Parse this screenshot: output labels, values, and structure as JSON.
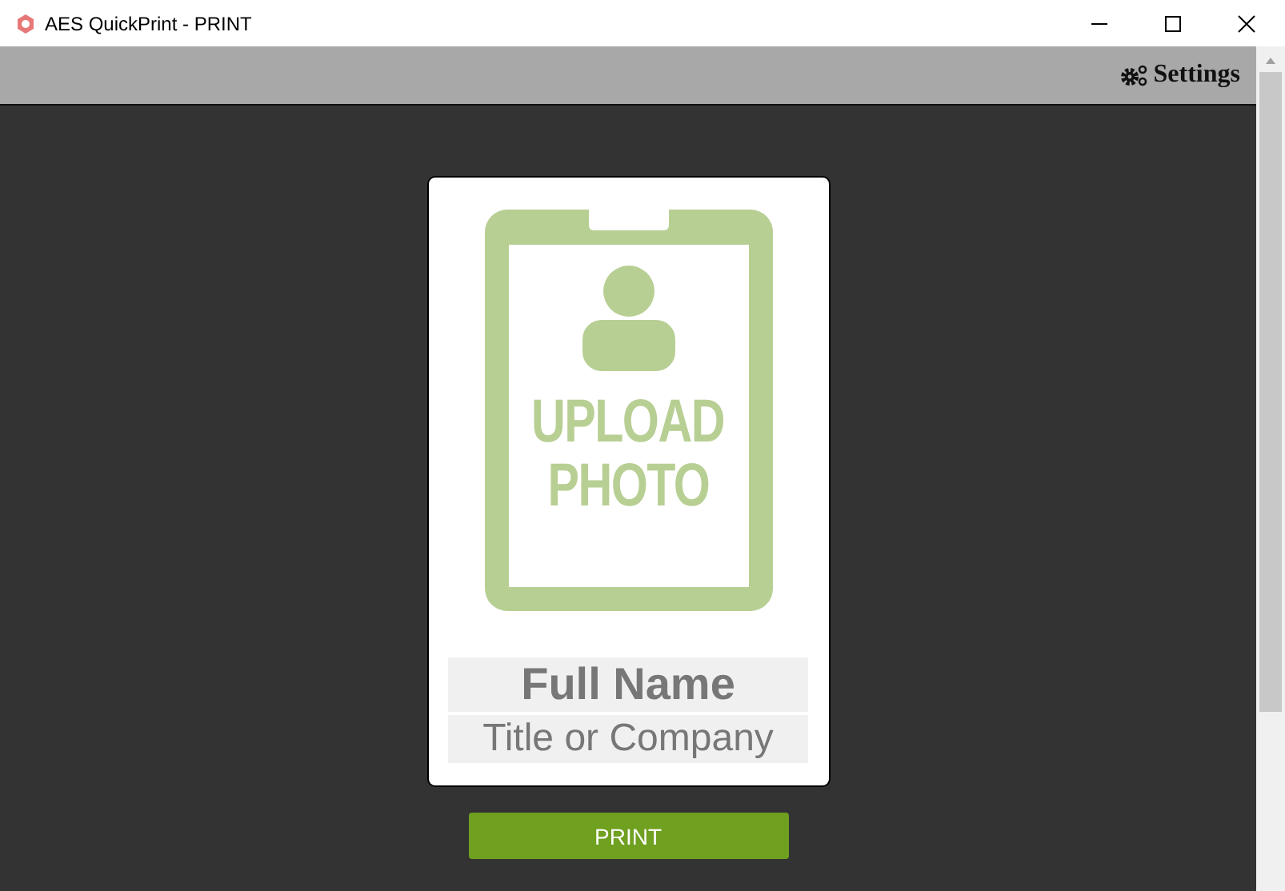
{
  "window": {
    "title": "AES QuickPrint - PRINT"
  },
  "toolbar": {
    "settings": "Settings"
  },
  "badge": {
    "upload_lines": [
      "UPLOAD",
      "PHOTO"
    ],
    "name": {
      "placeholder": "Full Name"
    },
    "title": {
      "placeholder": "Title or Company"
    }
  },
  "print_button": "PRINT"
}
